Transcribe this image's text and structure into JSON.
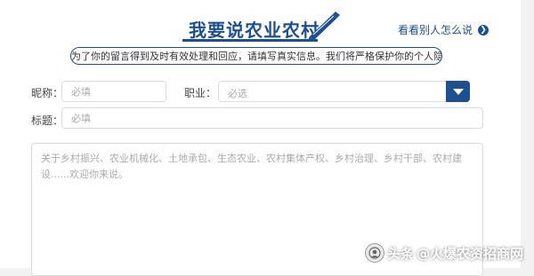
{
  "header": {
    "title": "我要说农业农村",
    "see_others": "看看别人怎么说",
    "notice": "为了你的留言得到及时有效处理和回应，请填写真实信息。我们将严格保护你的个人隐私。"
  },
  "form": {
    "nickname": {
      "label": "昵称：",
      "placeholder": "必填"
    },
    "occupation": {
      "label": "职业：",
      "value": "必选"
    },
    "subject": {
      "label": "标题：",
      "placeholder": "必填"
    },
    "message": {
      "placeholder": "关于乡村振兴、农业机械化、土地承包、生态农业、农村集体产权、乡村治理、乡村干部、农村建设......欢迎你来说。"
    }
  },
  "watermark": {
    "prefix": "头条",
    "author": "@火爆农资招商网"
  },
  "colors": {
    "brand_blue": "#1e4f8f",
    "border_gray": "#dcdcdc",
    "placeholder_gray": "#aaaaaa"
  },
  "icons": [
    "pen-icon",
    "arrow-right-circle-icon",
    "dropdown-arrow-icon",
    "toutiao-logo-icon"
  ]
}
